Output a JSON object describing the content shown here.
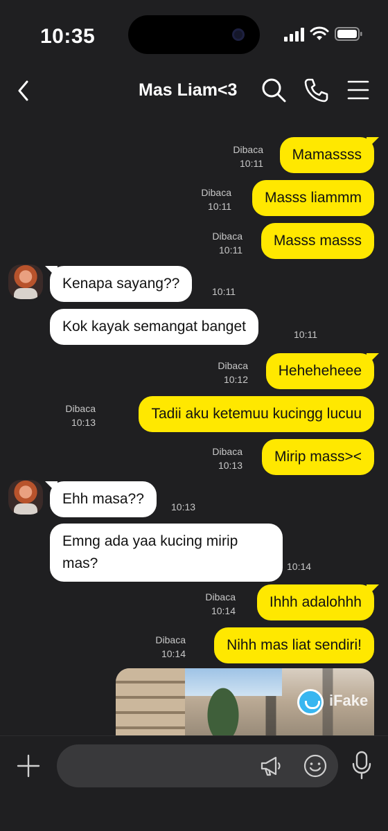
{
  "status_bar": {
    "time": "10:35"
  },
  "header": {
    "title": "Mas Liam<3"
  },
  "icons": {
    "back": "chevron-left-icon",
    "search": "search-icon",
    "call": "phone-icon",
    "menu": "menu-icon"
  },
  "messages": [
    {
      "from": "me",
      "text": "Mamassss",
      "read": "Dibaca",
      "time": "10:11"
    },
    {
      "from": "me",
      "text": "Masss liammm",
      "read": "Dibaca",
      "time": "10:11"
    },
    {
      "from": "me",
      "text": "Masss masss",
      "read": "Dibaca",
      "time": "10:11"
    },
    {
      "from": "them",
      "text": "Kenapa sayang??",
      "time": "10:11"
    },
    {
      "from": "them",
      "text": "Kok kayak semangat banget",
      "time": "10:11"
    },
    {
      "from": "me",
      "text": "Heheheheee",
      "read": "Dibaca",
      "time": "10:12"
    },
    {
      "from": "me",
      "text": "Tadii aku ketemuu kucingg lucuu",
      "read": "Dibaca",
      "time": "10:13"
    },
    {
      "from": "me",
      "text": "Mirip mass><",
      "read": "Dibaca",
      "time": "10:13"
    },
    {
      "from": "them",
      "text": "Ehh masa??",
      "time": "10:13"
    },
    {
      "from": "them",
      "text": "Emng ada yaa kucing mirip\nmas?",
      "time": "10:14"
    },
    {
      "from": "me",
      "text": "Ihhh adalohhh",
      "read": "Dibaca",
      "time": "10:14"
    },
    {
      "from": "me",
      "text": "Nihh mas liat sendiri!",
      "read": "Dibaca",
      "time": "10:14"
    }
  ],
  "photo": {
    "watermark": "iFake"
  },
  "input": {
    "placeholder": ""
  }
}
